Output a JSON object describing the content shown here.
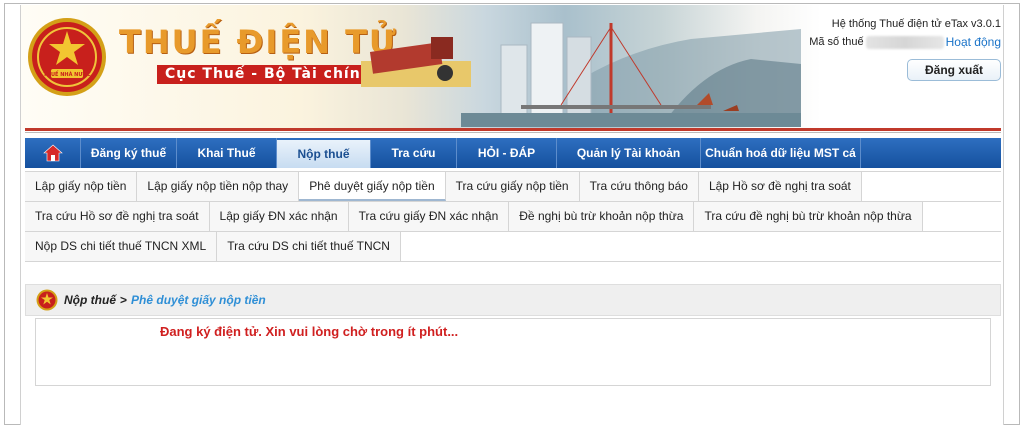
{
  "header": {
    "brand_title": "THUẾ ĐIỆN TỬ",
    "brand_subtitle": "Cục Thuế - Bộ Tài chính",
    "emblem_text": "THUẾ NHÀ NƯỚC",
    "system_version": "Hệ thống Thuế điện tử eTax v3.0.1",
    "mst_label": "Mã số thuế",
    "status": "Hoạt động",
    "logout_label": "Đăng xuất"
  },
  "main_nav": [
    {
      "label": "Đăng ký thuế"
    },
    {
      "label": "Khai Thuế"
    },
    {
      "label": "Nộp thuế"
    },
    {
      "label": "Tra cứu"
    },
    {
      "label": "HỎI - ĐÁP"
    },
    {
      "label": "Quản lý Tài khoản"
    },
    {
      "label": "Chuẩn hoá dữ liệu MST cá nhân"
    }
  ],
  "sub_nav": [
    "Lập giấy nộp tiền",
    "Lập giấy nộp tiền nộp thay",
    "Phê duyệt giấy nộp tiền",
    "Tra cứu giấy nộp tiền",
    "Tra cứu thông báo",
    "Lập Hồ sơ đề nghị tra soát",
    "Tra cứu Hồ sơ đề nghị tra soát",
    "Lập giấy ĐN xác nhận",
    "Tra cứu giấy ĐN xác nhận",
    "Đề nghị bù trừ khoản nộp thừa",
    "Tra cứu đề nghị bù trừ khoản nộp thừa",
    "Nộp DS chi tiết thuế TNCN XML",
    "Tra cứu DS chi tiết thuế TNCN"
  ],
  "breadcrumb": {
    "section": "Nộp thuế",
    "separator": ">",
    "current": "Phê duyệt giấy nộp tiền"
  },
  "message": "Đang ký điện tử. Xin vui lòng chờ trong ít phút...",
  "colors": {
    "nav_blue": "#1b5aa8",
    "accent_red": "#c8201c",
    "link_blue": "#2f8fd6",
    "message_red": "#d02020"
  }
}
